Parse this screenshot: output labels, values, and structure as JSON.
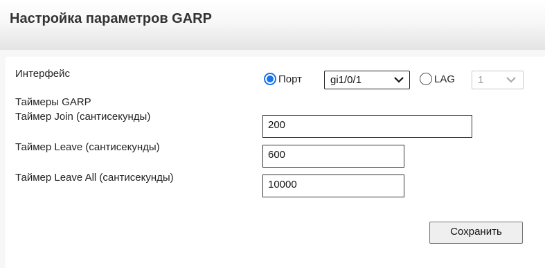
{
  "page": {
    "title": "Настройка параметров GARP"
  },
  "form": {
    "interface_label": "Интерфейс",
    "port_option_label": "Порт",
    "port_select_value": "gi1/0/1",
    "lag_option_label": "LAG",
    "lag_select_value": "1",
    "timers_heading": "Таймеры GARP",
    "join_label": "Таймер Join (сантисекунды)",
    "join_value": "200",
    "leave_label": "Таймер Leave (сантисекунды)",
    "leave_value": "600",
    "leave_all_label": "Таймер Leave All (сантисекунды)",
    "leave_all_value": "10000",
    "save_button_label": "Сохранить"
  },
  "state": {
    "selected_interface": "port",
    "lag_enabled": false
  },
  "colors": {
    "radio_accent": "#1a73e8"
  },
  "icons": [
    "chevron-down-icon"
  ]
}
